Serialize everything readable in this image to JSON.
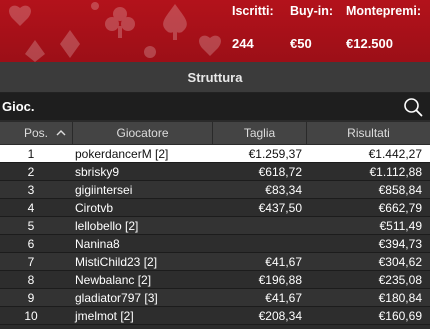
{
  "header": {
    "stats": [
      {
        "label": "Iscritti:",
        "value": "244"
      },
      {
        "label": "Buy-in:",
        "value": "€50"
      },
      {
        "label": "Montepremi:",
        "value": "€12.500"
      }
    ],
    "accent_color": "#b3121b"
  },
  "section_title": "Struttura",
  "search": {
    "placeholder": "Gioc.",
    "icon": "search-icon"
  },
  "table": {
    "columns": {
      "pos": "Pos.",
      "player": "Giocatore",
      "stack": "Taglia",
      "result": "Risultati"
    },
    "sort_icon": "chevron-up-icon",
    "rows": [
      {
        "pos": "1",
        "player": "pokerdancerM [2]",
        "stack": "€1.259,37",
        "result": "€1.442,27",
        "highlighted": true
      },
      {
        "pos": "2",
        "player": "sbrisky9",
        "stack": "€618,72",
        "result": "€1.112,88"
      },
      {
        "pos": "3",
        "player": "gigiintersei",
        "stack": "€83,34",
        "result": "€858,84"
      },
      {
        "pos": "4",
        "player": "Cirotvb",
        "stack": "€437,50",
        "result": "€662,79"
      },
      {
        "pos": "5",
        "player": "lellobello [2]",
        "stack": "",
        "result": "€511,49"
      },
      {
        "pos": "6",
        "player": "Nanina8",
        "stack": "",
        "result": "€394,73"
      },
      {
        "pos": "7",
        "player": "MistiChild23 [2]",
        "stack": "€41,67",
        "result": "€304,62"
      },
      {
        "pos": "8",
        "player": "Newbalanc [2]",
        "stack": "€196,88",
        "result": "€235,08"
      },
      {
        "pos": "9",
        "player": "gladiator797 [3]",
        "stack": "€41,67",
        "result": "€180,84"
      },
      {
        "pos": "10",
        "player": "jmelmot [2]",
        "stack": "€208,34",
        "result": "€160,69"
      }
    ]
  }
}
